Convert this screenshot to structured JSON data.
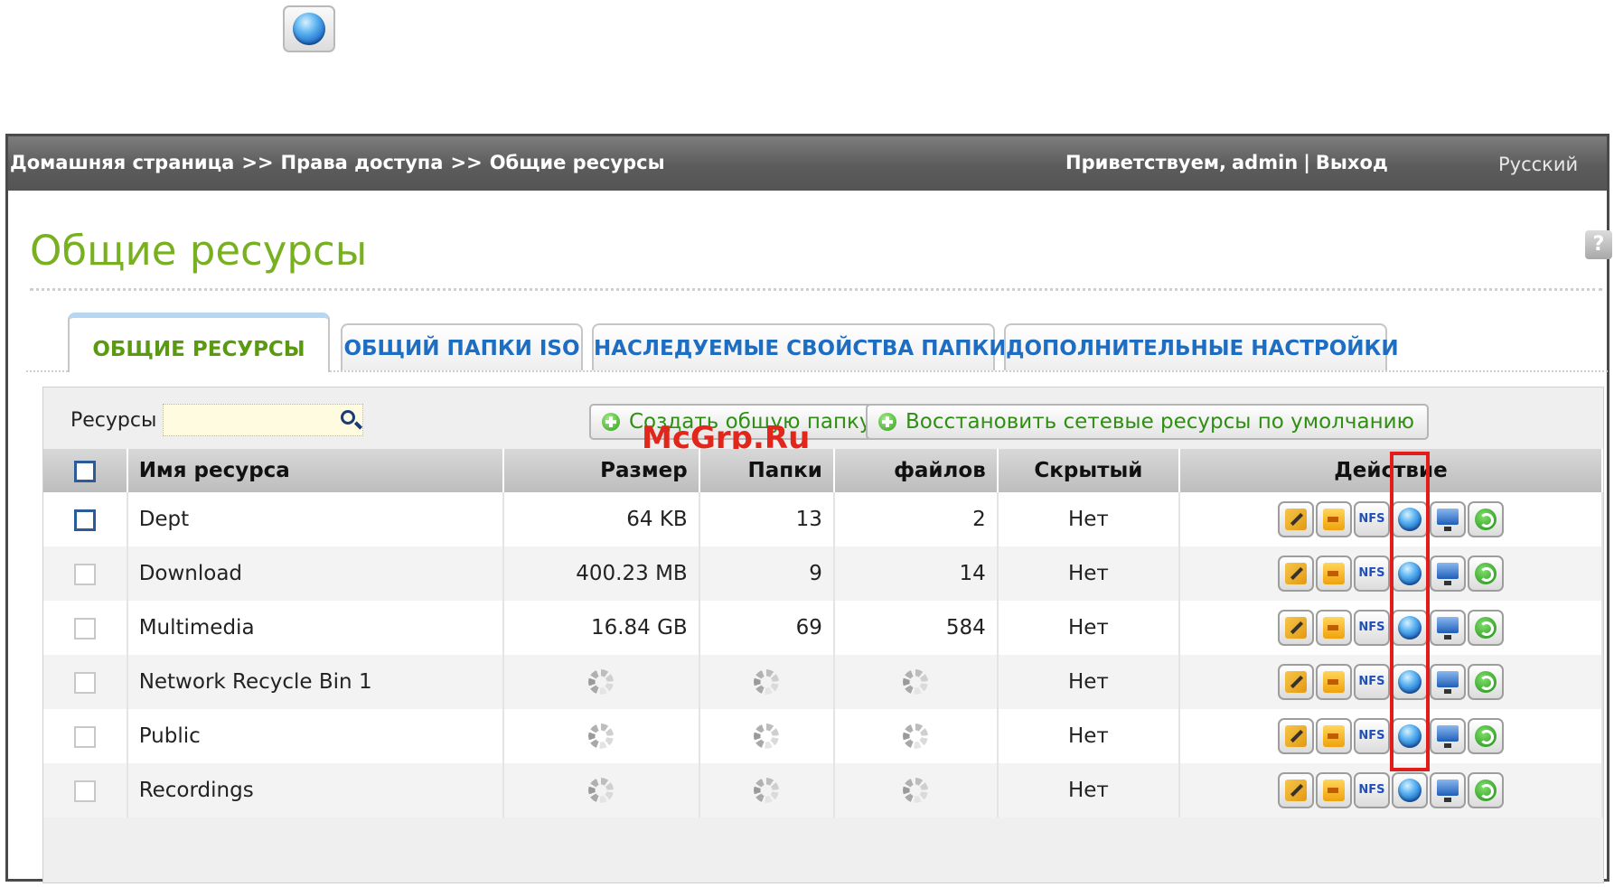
{
  "top_icon": "globe-icon",
  "topbar": {
    "breadcrumb": [
      "Домашняя страница",
      "Права доступа",
      "Общие ресурсы"
    ],
    "breadcrumb_sep": ">>",
    "welcome": "Приветствуем,",
    "user": "admin",
    "divider": "|",
    "logout": "Выход",
    "language": "Русский"
  },
  "help": "?",
  "page_title": "Общие ресурсы",
  "tabs": [
    "ОБЩИЕ РЕСУРСЫ",
    "ОБЩИЙ ПАПКИ ISO",
    "НАСЛЕДУЕМЫЕ СВОЙСТВА ПАПКИ",
    "ДОПОЛНИТЕЛЬНЫЕ НАСТРОЙКИ"
  ],
  "toolbar": {
    "resources_label": "Ресурсы",
    "search_value": "",
    "create_button": "Создать общую папку",
    "restore_button": "Восстановить сетевые ресурсы по умолчанию"
  },
  "watermark": "McGrp.Ru",
  "table": {
    "headers": [
      "Имя ресурса",
      "Размер",
      "Папки",
      "файлов",
      "Скрытый",
      "Действие"
    ],
    "rows": [
      {
        "name": "Dept",
        "size": "64 KB",
        "folders": "13",
        "files": "2",
        "hidden": "Нет"
      },
      {
        "name": "Download",
        "size": "400.23 MB",
        "folders": "9",
        "files": "14",
        "hidden": "Нет"
      },
      {
        "name": "Multimedia",
        "size": "16.84 GB",
        "folders": "69",
        "files": "584",
        "hidden": "Нет"
      },
      {
        "name": "Network Recycle Bin 1",
        "size": "",
        "folders": "",
        "files": "",
        "hidden": "Нет"
      },
      {
        "name": "Public",
        "size": "",
        "folders": "",
        "files": "",
        "hidden": "Нет"
      },
      {
        "name": "Recordings",
        "size": "",
        "folders": "",
        "files": "",
        "hidden": "Нет"
      }
    ],
    "loading_rows": [
      3,
      4,
      5
    ],
    "action_icons": [
      "edit-icon",
      "permissions-icon",
      "nfs-icon",
      "web-access-icon",
      "monitor-icon",
      "refresh-icon"
    ],
    "nfs_text": "NFS"
  },
  "colors": {
    "title_green": "#78b020",
    "tab_blue": "#1d6dc2",
    "active_tab_green": "#5a9a10",
    "highlight_red": "#e21b1b",
    "watermark_red": "#e1261c"
  }
}
